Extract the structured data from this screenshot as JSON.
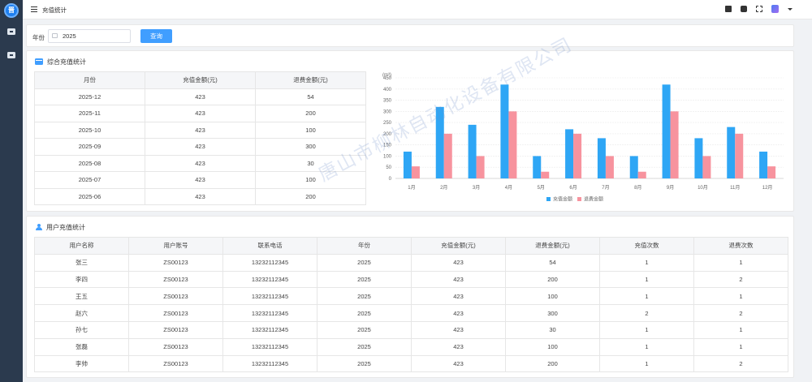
{
  "app": {
    "logo_text": "晋",
    "page_title": "充值统计"
  },
  "filter": {
    "year_label": "年份",
    "year_value": "2025",
    "query_label": "查询"
  },
  "summary": {
    "title": "综合充值统计",
    "columns": [
      "月份",
      "充值金额(元)",
      "退费金额(元)"
    ],
    "rows": [
      [
        "2025-12",
        "423",
        "54"
      ],
      [
        "2025-11",
        "423",
        "200"
      ],
      [
        "2025-10",
        "423",
        "100"
      ],
      [
        "2025-09",
        "423",
        "300"
      ],
      [
        "2025-08",
        "423",
        "30"
      ],
      [
        "2025-07",
        "423",
        "100"
      ],
      [
        "2025-06",
        "423",
        "200"
      ]
    ]
  },
  "chart_data": {
    "type": "bar",
    "unit": "(m³)",
    "categories": [
      "1月",
      "2月",
      "3月",
      "4月",
      "5月",
      "6月",
      "7月",
      "8月",
      "9月",
      "10月",
      "11月",
      "12月"
    ],
    "series": [
      {
        "name": "充值金额",
        "color": "#2ea6f5",
        "values": [
          120,
          320,
          240,
          420,
          100,
          220,
          180,
          100,
          420,
          180,
          230,
          120
        ]
      },
      {
        "name": "退费金额",
        "color": "#f7939e",
        "values": [
          54,
          200,
          100,
          300,
          30,
          200,
          100,
          30,
          300,
          100,
          200,
          54
        ]
      }
    ],
    "yticks": [
      0,
      50,
      100,
      150,
      200,
      250,
      300,
      350,
      400,
      450
    ],
    "ylim": [
      0,
      450
    ],
    "grid": true,
    "legend": "bottom-center"
  },
  "users": {
    "title": "用户充值统计",
    "columns": [
      "用户名称",
      "用户账号",
      "联系电话",
      "年份",
      "充值金额(元)",
      "退费金额(元)",
      "充值次数",
      "退费次数"
    ],
    "rows": [
      [
        "张三",
        "ZS00123",
        "13232112345",
        "2025",
        "423",
        "54",
        "1",
        "1"
      ],
      [
        "李四",
        "ZS00123",
        "13232112345",
        "2025",
        "423",
        "200",
        "1",
        "2"
      ],
      [
        "王五",
        "ZS00123",
        "13232112345",
        "2025",
        "423",
        "100",
        "1",
        "1"
      ],
      [
        "赵六",
        "ZS00123",
        "13232112345",
        "2025",
        "423",
        "300",
        "2",
        "2"
      ],
      [
        "孙七",
        "ZS00123",
        "13232112345",
        "2025",
        "423",
        "30",
        "1",
        "1"
      ],
      [
        "张磊",
        "ZS00123",
        "13232112345",
        "2025",
        "423",
        "100",
        "1",
        "1"
      ],
      [
        "李帅",
        "ZS00123",
        "13232112345",
        "2025",
        "423",
        "200",
        "1",
        "2"
      ]
    ]
  },
  "watermark": "唐山市柳林自动化设备有限公司"
}
